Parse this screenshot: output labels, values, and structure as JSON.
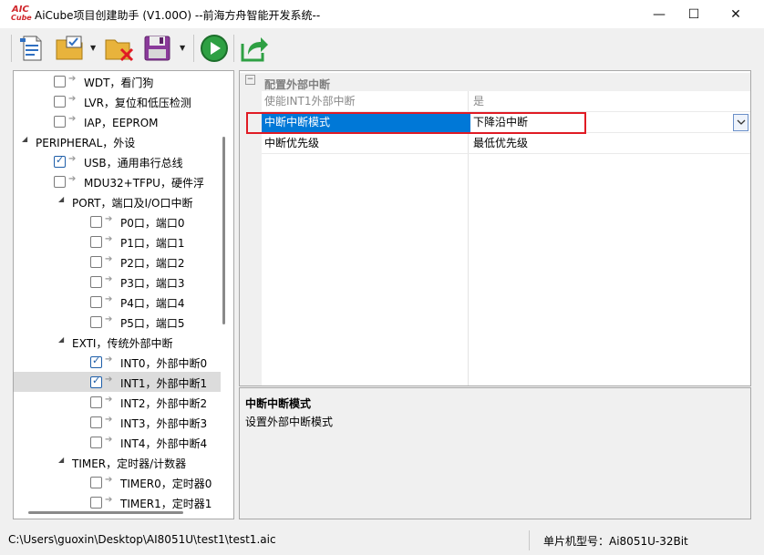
{
  "window": {
    "title": "AiCube项目创建助手 (V1.00O) --前海方舟智能开发系统--",
    "logo_top": "AIC",
    "logo_bottom": "Cube",
    "minimize": "—",
    "maximize": "☐",
    "close": "✕"
  },
  "toolbar": {
    "items": [
      "new-document-icon",
      "open-project-icon",
      "close-project-icon",
      "save-icon",
      "run-icon",
      "export-icon"
    ]
  },
  "tree": {
    "items": [
      {
        "label": "WDT，看门狗",
        "checked": false
      },
      {
        "label": "LVR，复位和低压检测",
        "checked": false
      },
      {
        "label": "IAP，EEPROM",
        "checked": false
      },
      {
        "label": "PERIPHERAL，外设"
      },
      {
        "label": "USB，通用串行总线",
        "checked": true
      },
      {
        "label": "MDU32+TFPU，硬件浮",
        "checked": false
      },
      {
        "label": "PORT，端口及I/O口中断"
      },
      {
        "label": "P0口，端口0",
        "checked": false
      },
      {
        "label": "P1口，端口1",
        "checked": false
      },
      {
        "label": "P2口，端口2",
        "checked": false
      },
      {
        "label": "P3口，端口3",
        "checked": false
      },
      {
        "label": "P4口，端口4",
        "checked": false
      },
      {
        "label": "P5口，端口5",
        "checked": false
      },
      {
        "label": "EXTI，传统外部中断"
      },
      {
        "label": "INT0，外部中断0",
        "checked": true
      },
      {
        "label": "INT1，外部中断1",
        "checked": true
      },
      {
        "label": "INT2，外部中断2",
        "checked": false
      },
      {
        "label": "INT3，外部中断3",
        "checked": false
      },
      {
        "label": "INT4，外部中断4",
        "checked": false
      },
      {
        "label": "TIMER，定时器/计数器"
      },
      {
        "label": "TIMER0，定时器0",
        "checked": false
      },
      {
        "label": "TIMER1，定时器1",
        "checked": false
      }
    ]
  },
  "properties": {
    "category": "配置外部中断",
    "rows": [
      {
        "name": "使能INT1外部中断",
        "value": "是"
      },
      {
        "name": "中断中断模式",
        "value": "下降沿中断"
      },
      {
        "name": "中断优先级",
        "value": "最低优先级"
      }
    ]
  },
  "description": {
    "title": "中断中断模式",
    "text": "设置外部中断模式"
  },
  "status": {
    "path": "C:\\Users\\guoxin\\Desktop\\AI8051U\\test1\\test1.aic",
    "model": "单片机型号：Ai8051U-32Bit"
  }
}
